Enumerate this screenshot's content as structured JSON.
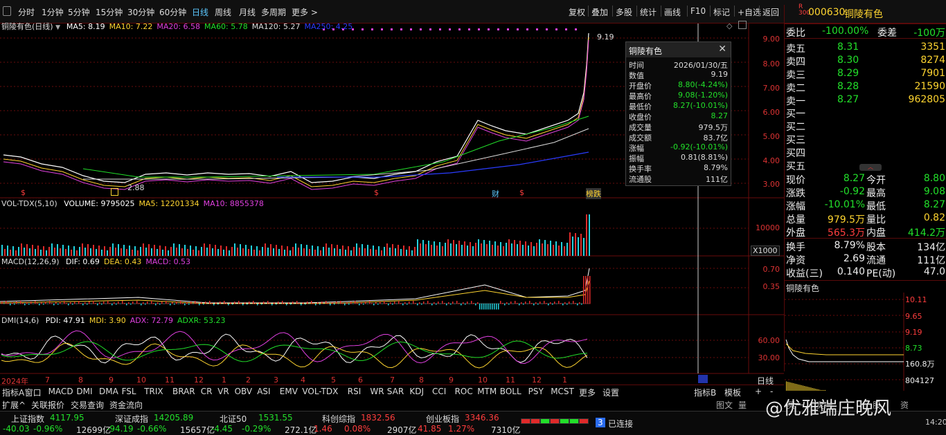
{
  "toolbar": {
    "periods": [
      "分时",
      "1分钟",
      "5分钟",
      "15分钟",
      "30分钟",
      "60分钟",
      "日线",
      "周线",
      "月线",
      "多周期",
      "更多 >"
    ],
    "active_period": "日线",
    "right_buttons": [
      "复权",
      "叠加",
      "多股",
      "统计",
      "画线",
      "F10",
      "标记",
      "+自选",
      "返回"
    ]
  },
  "stock": {
    "code_badge": "R",
    "index_badge": "300",
    "code": "000630",
    "name": "铜陵有色"
  },
  "main_pane": {
    "title": "铜陵有色(日线)",
    "ma": [
      {
        "label": "MA5: 8.19",
        "color": "#ffffff"
      },
      {
        "label": "MA10: 7.22",
        "color": "#ffd530"
      },
      {
        "label": "MA20: 6.58",
        "color": "#e040e0"
      },
      {
        "label": "MA60: 5.78",
        "color": "#22e02a"
      },
      {
        "label": "MA120: 5.27",
        "color": "#dddddd"
      },
      {
        "label": "MA250: 4.25",
        "color": "#2a3cff"
      }
    ],
    "y_ticks": [
      "9.00",
      "8.00",
      "7.00",
      "6.00",
      "5.00",
      "4.00",
      "3.00"
    ],
    "high_label": "9.19",
    "low_label": "2.88",
    "markers": [
      "$",
      "$",
      "财",
      "$",
      "榜跌"
    ]
  },
  "volume_pane": {
    "title": "VOL-TDX(5,10)",
    "values": [
      {
        "label": "VOLUME: 9795025",
        "color": "#ffffff"
      },
      {
        "label": "MA5: 12201334",
        "color": "#ffd530"
      },
      {
        "label": "MA10: 8855378",
        "color": "#e040e0"
      }
    ],
    "y_ticks": [
      "10000"
    ],
    "unit": "X1000"
  },
  "macd_pane": {
    "title": "MACD(12,26,9)",
    "values": [
      {
        "label": "DIF: 0.69",
        "color": "#ffffff"
      },
      {
        "label": "DEA: 0.43",
        "color": "#ffd530"
      },
      {
        "label": "MACD: 0.53",
        "color": "#e040e0"
      }
    ],
    "y_ticks": [
      "0.70",
      "0.35"
    ]
  },
  "dmi_pane": {
    "title": "DMI(14,6)",
    "values": [
      {
        "label": "PDI: 47.91",
        "color": "#ffffff"
      },
      {
        "label": "MDI: 3.90",
        "color": "#ffd530"
      },
      {
        "label": "ADX: 72.79",
        "color": "#e040e0"
      },
      {
        "label": "ADXR: 53.23",
        "color": "#22e02a"
      }
    ],
    "y_ticks": [
      "60.00",
      "30.00"
    ]
  },
  "x_axis": {
    "labels": [
      "2024年",
      "7",
      "8",
      "9",
      "10",
      "11",
      "12",
      "1",
      "2",
      "3",
      "4",
      "5",
      "6",
      "7",
      "8",
      "9",
      "10",
      "11",
      "12",
      "1"
    ],
    "right_label": "日线"
  },
  "tooltip": {
    "title": "铜陵有色",
    "rows": [
      {
        "label": "时间",
        "value": "2026/01/30/五",
        "color": "#dddddd"
      },
      {
        "label": "数值",
        "value": "9.19",
        "color": "#dddddd"
      },
      {
        "label": "开盘价",
        "value": "8.80(-4.24%)",
        "color": "#22e02a"
      },
      {
        "label": "最高价",
        "value": "9.08(-1.20%)",
        "color": "#22e02a"
      },
      {
        "label": "最低价",
        "value": "8.27(-10.01%)",
        "color": "#22e02a"
      },
      {
        "label": "收盘价",
        "value": "8.27",
        "color": "#22e02a"
      },
      {
        "label": "成交量",
        "value": "979.5万",
        "color": "#dddddd"
      },
      {
        "label": "成交额",
        "value": "83.7亿",
        "color": "#dddddd"
      },
      {
        "label": "涨幅",
        "value": "-0.92(-10.01%)",
        "color": "#22e02a"
      },
      {
        "label": "振幅",
        "value": "0.81(8.81%)",
        "color": "#dddddd"
      },
      {
        "label": "换手率",
        "value": "8.79%",
        "color": "#dddddd"
      },
      {
        "label": "流通股",
        "value": "111亿",
        "color": "#dddddd"
      }
    ]
  },
  "order_book": {
    "ratio": {
      "label": "委比",
      "value": "-100.00%",
      "label2": "委差",
      "value2": "-100万"
    },
    "asks": [
      {
        "label": "卖五",
        "price": "8.31",
        "vol": "3351"
      },
      {
        "label": "卖四",
        "price": "8.30",
        "vol": "8274"
      },
      {
        "label": "卖三",
        "price": "8.29",
        "vol": "7901"
      },
      {
        "label": "卖二",
        "price": "8.28",
        "vol": "21590"
      },
      {
        "label": "卖一",
        "price": "8.27",
        "vol": "962805"
      }
    ],
    "bids": [
      "买一",
      "买二",
      "买三",
      "买四",
      "买五"
    ]
  },
  "quote": [
    {
      "l1": "现价",
      "v1": "8.27",
      "c1": "#22e02a",
      "l2": "今开",
      "v2": "8.80",
      "c2": "#22e02a"
    },
    {
      "l1": "涨跌",
      "v1": "-0.92",
      "c1": "#22e02a",
      "l2": "最高",
      "v2": "9.08",
      "c2": "#22e02a"
    },
    {
      "l1": "涨幅",
      "v1": "-10.01%",
      "c1": "#22e02a",
      "l2": "最低",
      "v2": "8.27",
      "c2": "#22e02a"
    },
    {
      "l1": "总量",
      "v1": "979.5万",
      "c1": "#ffd530",
      "l2": "量比",
      "v2": "0.82",
      "c2": "#ffd530"
    },
    {
      "l1": "外盘",
      "v1": "565.3万",
      "c1": "#ff3d3d",
      "l2": "内盘",
      "v2": "414.2万",
      "c2": "#22e02a"
    },
    {
      "l1": "换手",
      "v1": "8.79%",
      "c1": "#eeeeee",
      "l2": "股本",
      "v2": "134亿",
      "c2": "#eeeeee"
    },
    {
      "l1": "净资",
      "v1": "2.69",
      "c1": "#eeeeee",
      "l2": "流通",
      "v2": "111亿",
      "c2": "#eeeeee"
    },
    {
      "l1": "收益(三)",
      "v1": "0.140",
      "c1": "#eeeeee",
      "l2": "PE(动)",
      "v2": "47.0",
      "c2": "#eeeeee"
    }
  ],
  "mini_chart": {
    "title": "铜陵有色",
    "y_ticks": [
      "10.11",
      "9.65",
      "9.19",
      "8.73",
      "160.8万",
      "804127"
    ]
  },
  "bottom_tabs": [
    "指标A",
    "窗口",
    "MACD",
    "DMI",
    "DMA",
    "FSL",
    "TRIX",
    "BRAR",
    "CR",
    "VR",
    "OBV",
    "ASI",
    "EMV",
    "VOL-TDX",
    "RSI",
    "WR",
    "SAR",
    "KDJ",
    "CCI",
    "ROC",
    "MTM",
    "BOLL",
    "PSY",
    "MCST",
    "更多",
    "设置"
  ],
  "bottom_right": [
    "指标B",
    "模板",
    "+",
    "-"
  ],
  "tabs2": [
    "扩展^",
    "关联报价",
    "交易查询",
    "资金流向"
  ],
  "tabs2_right": [
    "图文",
    "量",
    "买一",
    "卖一",
    "股",
    "资"
  ],
  "status": [
    {
      "name": "上证指数",
      "value": "4117.95",
      "color": "#22e02a",
      "chg": "-40.03",
      "pct": "-0.96%",
      "amt": "12699亿"
    },
    {
      "name": "深证成指",
      "value": "14205.89",
      "color": "#22e02a",
      "chg": "-94.19",
      "pct": "-0.66%",
      "amt": "15657亿"
    },
    {
      "name": "北证50",
      "value": "1531.55",
      "color": "#22e02a",
      "chg": "-4.45",
      "pct": "-0.29%",
      "amt": "272.1亿"
    },
    {
      "name": "科创综指",
      "value": "1832.56",
      "color": "#ff3d3d",
      "chg": "1.46",
      "pct": "0.08%",
      "amt": "2907亿"
    },
    {
      "name": "创业板指",
      "value": "3346.36",
      "color": "#ff3d3d",
      "chg": "41.85",
      "pct": "1.27%",
      "amt": "7310亿"
    }
  ],
  "connection": {
    "count": "3",
    "text": "已连接"
  },
  "watermark": "@优雅端庄晚风",
  "clock": "14:20"
}
